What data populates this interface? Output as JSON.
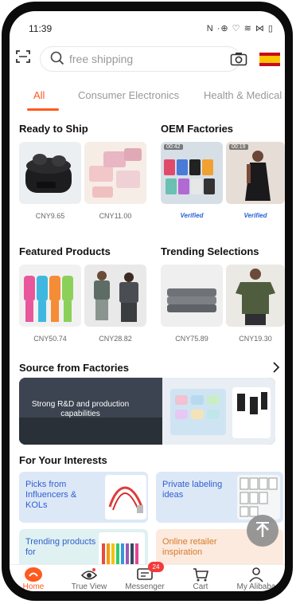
{
  "status_bar": {
    "time": "11:39",
    "indicators": "N ·⊕ ♡ ≋ ⋈ ▯"
  },
  "search": {
    "placeholder": "free shipping"
  },
  "tabs": [
    {
      "label": "All"
    },
    {
      "label": "Consumer Electronics"
    },
    {
      "label": "Health & Medical"
    }
  ],
  "sections": {
    "ready_to_ship": {
      "title": "Ready to Ship",
      "prices": [
        "CNY9.65",
        "CNY11.00"
      ]
    },
    "oem_factories": {
      "title": "OEM Factories",
      "verified": [
        "Verified",
        "Verified"
      ],
      "video_times": [
        "00:42",
        "00:19"
      ]
    },
    "featured_products": {
      "title": "Featured Products",
      "prices": [
        "CNY50.74",
        "CNY28.82"
      ]
    },
    "trending_selections": {
      "title": "Trending Selections",
      "prices": [
        "CNY75.89",
        "CNY19.30"
      ]
    },
    "source_from_factories": {
      "title": "Source from Factories",
      "banner_text": "Strong R&D and production capabilities"
    },
    "for_your_interests": {
      "title": "For Your Interests",
      "cards": [
        {
          "label": "Picks from Influencers & KOLs"
        },
        {
          "label": "Private labeling ideas"
        },
        {
          "label": "Trending products for"
        },
        {
          "label": "Online retailer inspiration"
        }
      ]
    }
  },
  "bottom_nav": [
    {
      "label": "Home"
    },
    {
      "label": "True View"
    },
    {
      "label": "Messenger",
      "badge": "24"
    },
    {
      "label": "Cart"
    },
    {
      "label": "My Alibaba"
    }
  ],
  "colors": {
    "accent": "#ff5a1f",
    "link_blue": "#2f5fd0",
    "badge_red": "#f23b3b"
  }
}
